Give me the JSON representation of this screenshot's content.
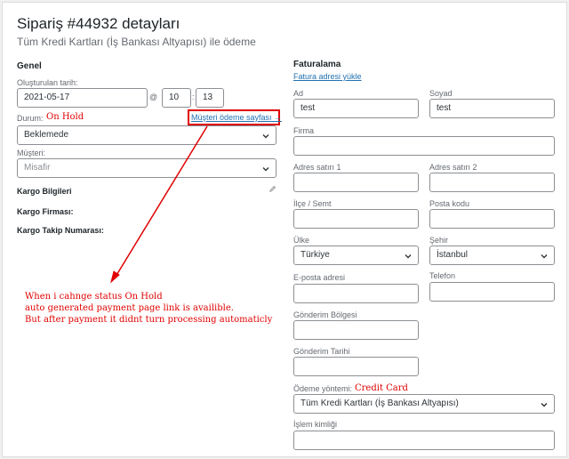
{
  "header": {
    "title": "Sipariş #44932 detayları",
    "subtitle": "Tüm Kredi Kartları (İş Bankası Altyapısı) ile ödeme"
  },
  "general": {
    "heading": "Genel",
    "created_label": "Oluşturulan tarih:",
    "date_value": "2021-05-17",
    "at_symbol": "@",
    "hour_value": "10",
    "minute_value": "13",
    "status_label": "Durum:",
    "status_annotation": "On Hold",
    "customer_payment_link": "Müşteri ödeme sayfası →",
    "status_select_value": "Beklemede",
    "customer_label": "Müşteri:",
    "customer_select_value": "Misafir"
  },
  "shipping": {
    "heading": "Kargo Bilgileri",
    "edit_icon": "pencil-icon",
    "company_label": "Kargo Firması:",
    "tracking_label": "Kargo Takip Numarası:"
  },
  "annotation": {
    "lines": [
      "When i cahnge status On Hold",
      "auto generated payment page link is availible.",
      "But after payment it didnt turn processing automaticly"
    ],
    "color": "#e00000"
  },
  "billing": {
    "heading": "Faturalama",
    "load_address_link": "Fatura adresi yükle",
    "first_name_label": "Ad",
    "first_name_value": "test",
    "last_name_label": "Soyad",
    "last_name_value": "test",
    "company_label": "Firma",
    "address1_label": "Adres satırı 1",
    "address2_label": "Adres satırı 2",
    "district_label": "İlçe / Semt",
    "postcode_label": "Posta kodu",
    "country_label": "Ülke",
    "country_value": "Türkiye",
    "city_label": "Şehir",
    "city_value": "İstanbul",
    "email_label": "E-posta adresi",
    "phone_label": "Telefon",
    "shipping_region_label": "Gönderim Bölgesi",
    "shipping_date_label": "Gönderim Tarihi",
    "payment_method_label": "Ödeme yöntemi:",
    "payment_annotation": "Credit Card",
    "payment_method_value": "Tüm Kredi Kartları (İş Bankası Altyapısı)",
    "transaction_id_label": "İşlem kimliği"
  }
}
